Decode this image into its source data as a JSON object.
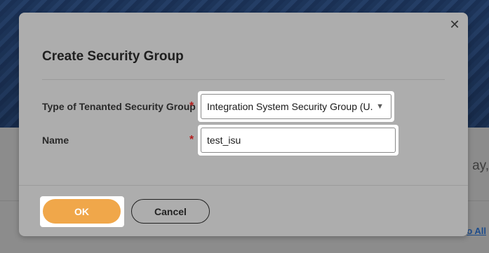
{
  "background": {
    "partial_text": "ay, ",
    "partial_link": "o All"
  },
  "dialog": {
    "title": "Create Security Group",
    "close_icon": "close-icon",
    "fields": [
      {
        "label": "Type of Tenanted Security Group",
        "required_marker": "*",
        "type": "select",
        "value": "Integration System Security Group (U..."
      },
      {
        "label": "Name",
        "required_marker": "*",
        "type": "text",
        "value": "test_isu"
      }
    ],
    "ok_label": "OK",
    "cancel_label": "Cancel"
  },
  "colors": {
    "primary_button": "#f0a74a",
    "required": "#b41e1e"
  }
}
